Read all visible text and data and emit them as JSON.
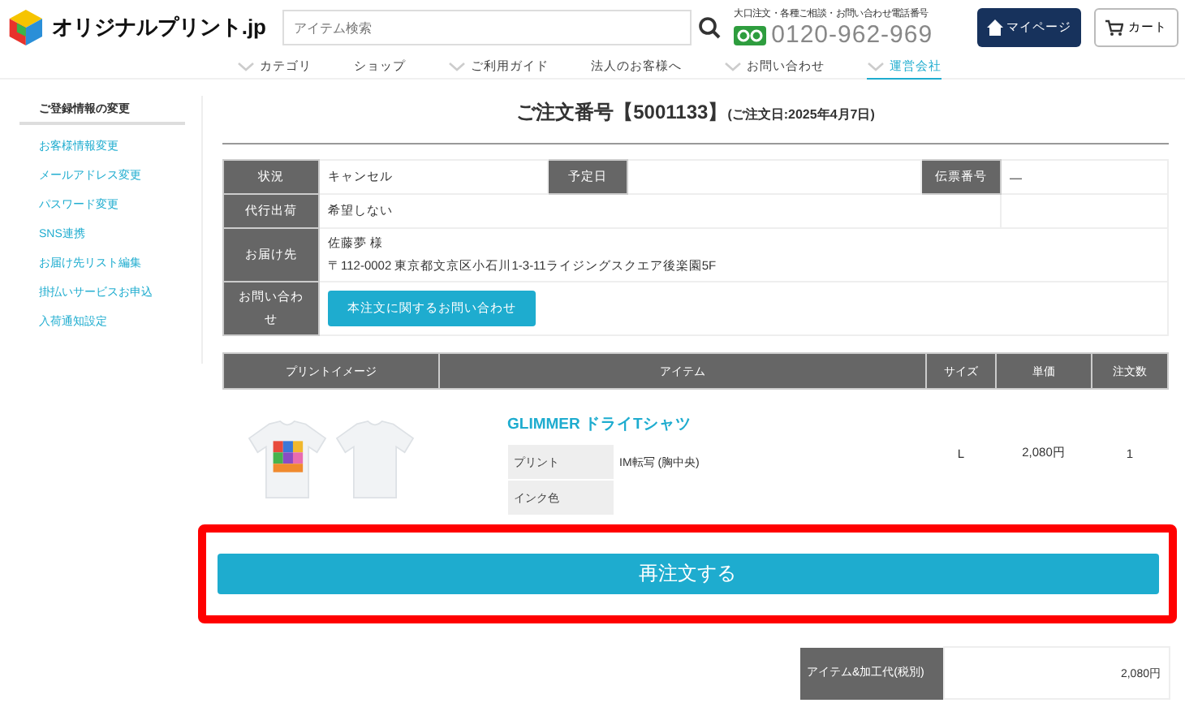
{
  "header": {
    "logo_text": "オリジナルプリント.jp",
    "search": {
      "placeholder": "アイテム検索"
    },
    "phone_caption": "大口注文・各種ご相談・お問い合わせ電話番号",
    "phone": "0120-962-969",
    "mypage": "マイページ",
    "cart": "カート"
  },
  "nav": [
    {
      "label": "カテゴリ",
      "kind": "dropdown",
      "selected": false
    },
    {
      "label": "ショップ",
      "kind": "link",
      "selected": false
    },
    {
      "label": "ご利用ガイド",
      "kind": "dropdown",
      "selected": false
    },
    {
      "label": "法人のお客様へ",
      "kind": "link",
      "selected": false
    },
    {
      "label": "お問い合わせ",
      "kind": "dropdown",
      "selected": false
    },
    {
      "label": "運営会社",
      "kind": "dropdown",
      "selected": true
    }
  ],
  "sidebar": {
    "title": "ご登録情報の変更",
    "items": [
      "お客様情報変更",
      "メールアドレス変更",
      "パスワード変更",
      "SNS連携",
      "お届け先リスト編集",
      "掛払いサービスお申込",
      "入荷通知設定"
    ]
  },
  "order": {
    "title": "ご注文番号【5001133】",
    "date": "(ご注文日:2025年4月7日)",
    "status": {
      "label": "状況",
      "value": "キャンセル"
    },
    "scheduled": {
      "label": "予定日"
    },
    "slip": {
      "label": "伝票番号",
      "value": "—"
    },
    "proxy": {
      "label": "代行出荷",
      "value": "希望しない"
    },
    "delivery": {
      "label": "お届け先",
      "name": "佐藤夢 様",
      "address": "〒112-0002 東京都文京区小石川1-3-11ライジングスクエア後楽園5F"
    },
    "inquiry": {
      "label": "お問い合わせ",
      "button": "本注文に関するお問い合わせ"
    }
  },
  "products": {
    "columns": [
      "プリントイメージ",
      "アイテム",
      "サイズ",
      "単価",
      "注文数"
    ],
    "items": [
      {
        "name": "GLIMMER ドライTシャツ",
        "details": [
          {
            "label": "プリント",
            "value": "IM転写 (胸中央)"
          },
          {
            "label": "インク色"
          }
        ],
        "size": "L",
        "price": "2,080円",
        "qty": "1"
      }
    ]
  },
  "reorder_button": "再注文する",
  "summary": {
    "label": "アイテム&加工代(税別)",
    "value": "2,080円"
  }
}
